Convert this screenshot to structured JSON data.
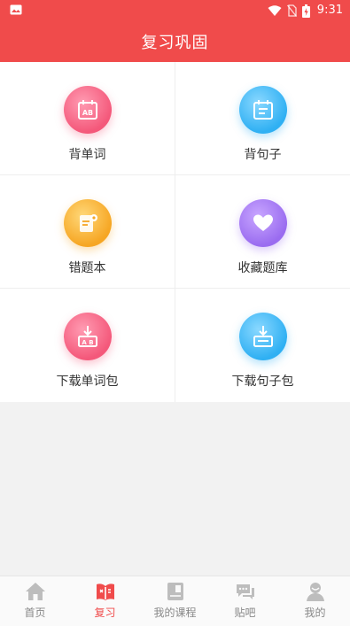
{
  "status_bar": {
    "time": "9:31"
  },
  "header": {
    "title": "复习巩固"
  },
  "grid": {
    "items": [
      {
        "label": "背单词",
        "icon": "calendar-ab-icon"
      },
      {
        "label": "背句子",
        "icon": "calendar-lines-icon"
      },
      {
        "label": "错题本",
        "icon": "notebook-icon"
      },
      {
        "label": "收藏题库",
        "icon": "heart-icon"
      },
      {
        "label": "下载单词包",
        "icon": "download-ab-icon"
      },
      {
        "label": "下载句子包",
        "icon": "download-tray-icon"
      }
    ]
  },
  "tab_bar": {
    "tabs": [
      {
        "label": "首页",
        "icon": "home-icon"
      },
      {
        "label": "复习",
        "icon": "book-icon",
        "active": true
      },
      {
        "label": "我的课程",
        "icon": "course-icon"
      },
      {
        "label": "贴吧",
        "icon": "chat-icon"
      },
      {
        "label": "我的",
        "icon": "person-icon"
      }
    ]
  },
  "colors": {
    "brand": "#f04b4b",
    "pink": "#f4587a",
    "blue": "#2fb0f3",
    "orange": "#f6a623",
    "purple": "#9a6cf0"
  }
}
